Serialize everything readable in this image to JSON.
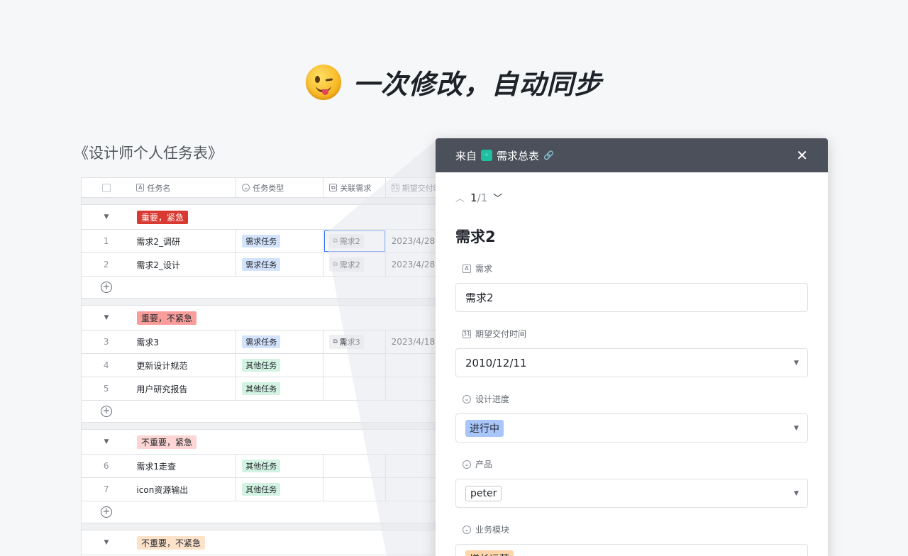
{
  "headline": "一次修改，自动同步",
  "table_title": "《设计师个人任务表》",
  "columns": [
    "任务名",
    "任务类型",
    "关联需求",
    "期望交付时间"
  ],
  "groups": [
    {
      "label": "重要，紧急",
      "color": "#d83931",
      "text_color": "#ffffff"
    },
    {
      "label": "重要，不紧急",
      "color": "#f99d9b",
      "text_color": "#1f2329"
    },
    {
      "label": "不重要，紧急",
      "color": "#fcd5d4",
      "text_color": "#1f2329"
    },
    {
      "label": "不重要，不紧急",
      "color": "#fde2ca",
      "text_color": "#1f2329"
    }
  ],
  "rows": [
    {
      "num": "1",
      "name": "需求2_调研",
      "type": "需求任务",
      "link": "需求2",
      "date": "2023/4/28"
    },
    {
      "num": "2",
      "name": "需求2_设计",
      "type": "需求任务",
      "link": "需求2",
      "date": "2023/4/28"
    },
    {
      "num": "3",
      "name": "需求3",
      "type": "需求任务",
      "link": "需求3",
      "date": "2023/4/18"
    },
    {
      "num": "4",
      "name": "更新设计规范",
      "type": "其他任务",
      "link": "",
      "date": ""
    },
    {
      "num": "5",
      "name": "用户研究报告",
      "type": "其他任务",
      "link": "",
      "date": ""
    },
    {
      "num": "6",
      "name": "需求1走查",
      "type": "其他任务",
      "link": "",
      "date": ""
    },
    {
      "num": "7",
      "name": "icon资源输出",
      "type": "其他任务",
      "link": "",
      "date": ""
    }
  ],
  "panel": {
    "from_label": "来自",
    "source_table": "需求总表",
    "pager_current": "1",
    "pager_total": "/1",
    "record_title": "需求2",
    "fields": [
      {
        "label": "需求",
        "value": "需求2"
      },
      {
        "label": "期望交付时间",
        "value": "2010/12/11"
      },
      {
        "label": "设计进度",
        "value": "进行中"
      },
      {
        "label": "产品",
        "value": "peter"
      },
      {
        "label": "业务模块",
        "value": "增长运营"
      }
    ]
  },
  "icons": {
    "text_field": "A",
    "single_select": "⌄",
    "link_field": "⧉",
    "date_field": "31",
    "group_arrow": "▼",
    "add": "+",
    "close": "✕",
    "chevron_up": "︿",
    "chevron_down": "﹀",
    "caret": "▼",
    "chain": "🔗"
  }
}
